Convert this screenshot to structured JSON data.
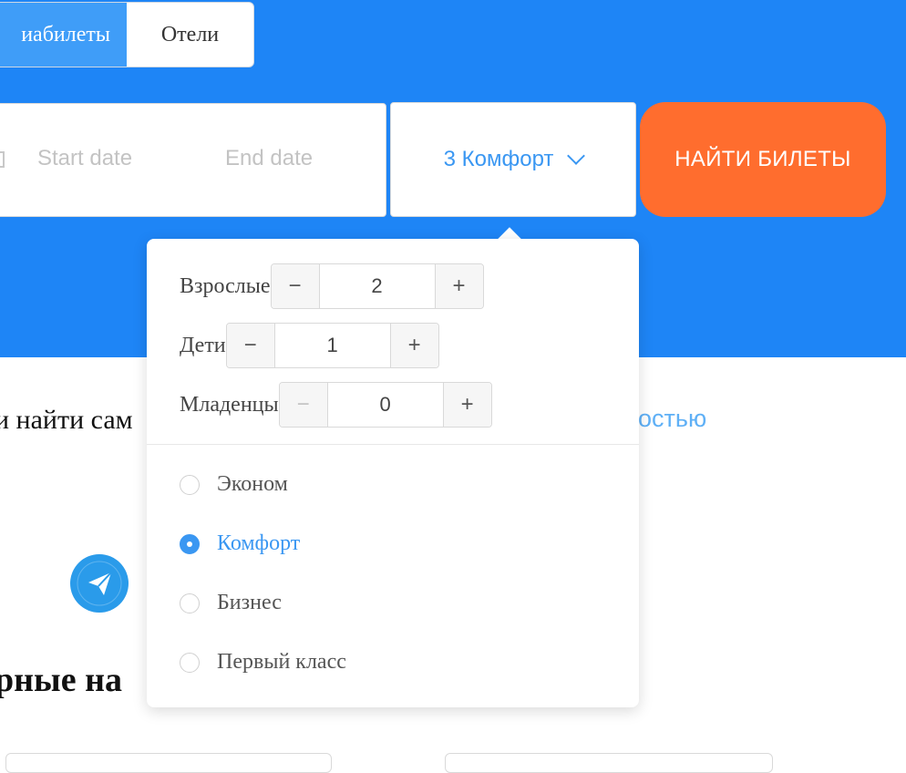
{
  "tabs": {
    "flights": "иабилеты",
    "hotels": "Отели"
  },
  "search": {
    "start_placeholder": "Start date",
    "end_placeholder": "End date",
    "button": "НАЙТИ БИЛЕТЫ"
  },
  "class_select": {
    "value": "3 Комфорт"
  },
  "content": {
    "promo_text": "и найти сам",
    "promo_link": "остью",
    "popular_heading": "рные на"
  },
  "passengers": [
    {
      "label": "Взрослые",
      "value": "2",
      "minus": "−",
      "plus": "+"
    },
    {
      "label": "Дети",
      "value": "1",
      "minus": "−",
      "plus": "+"
    },
    {
      "label": "Младенцы",
      "value": "0",
      "minus": "−",
      "plus": "+"
    }
  ],
  "classes": [
    {
      "label": "Эконом",
      "checked": false
    },
    {
      "label": "Комфорт",
      "checked": true
    },
    {
      "label": "Бизнес",
      "checked": false
    },
    {
      "label": "Первый класс",
      "checked": false
    }
  ],
  "colors": {
    "hero": "#1e85f6",
    "accent": "#3a97f2",
    "button": "#ff6d2e"
  }
}
